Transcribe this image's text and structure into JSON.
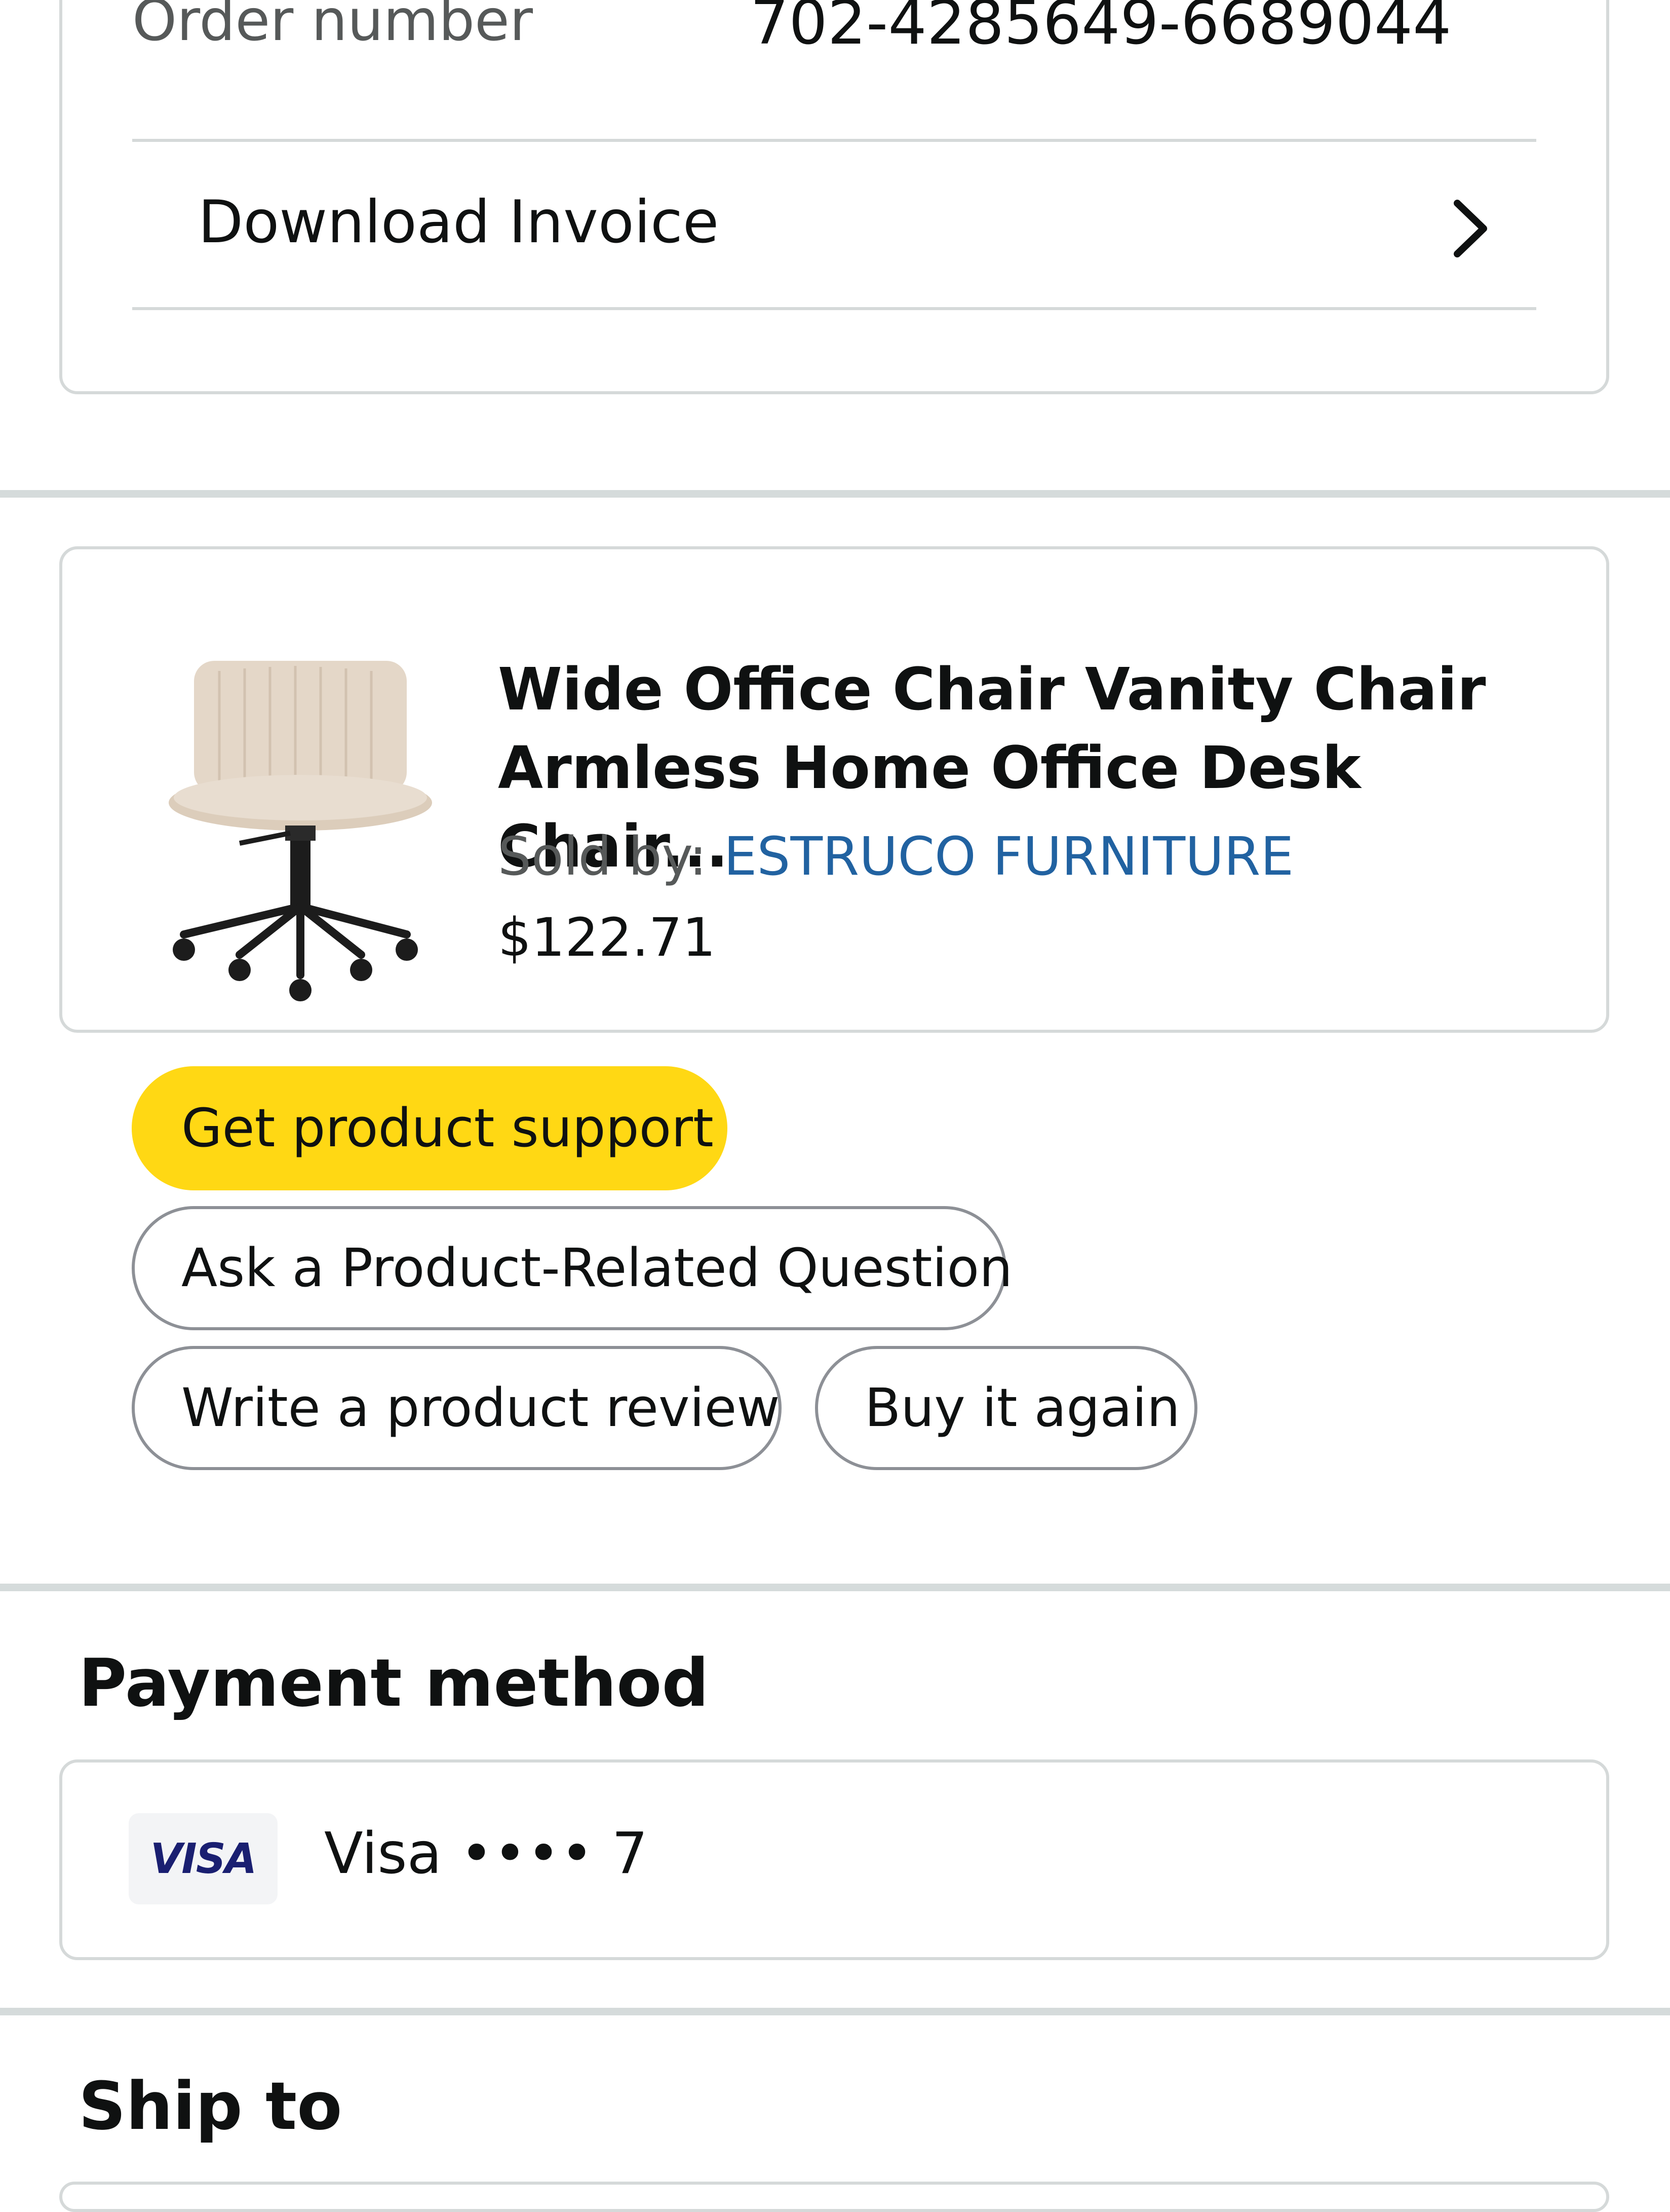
{
  "order": {
    "number_label": "Order number",
    "number_value": "702-4285649-6689044",
    "invoice_label": "Download Invoice"
  },
  "product": {
    "title": "Wide Office Chair Vanity Chair Armless Home Office Desk Chair...",
    "sold_by_label": "Sold by: ",
    "seller": "ESTRUCO FURNITURE",
    "price": "$122.71",
    "image_icon": "office-chair-image"
  },
  "actions": {
    "support": "Get product support",
    "question": "Ask a Product-Related Question",
    "review": "Write a product review",
    "buy_again": "Buy it again"
  },
  "payment": {
    "heading": "Payment method",
    "brand_logo": "VISA",
    "card_text": "Visa •••• 7"
  },
  "shipping": {
    "heading": "Ship to"
  },
  "colors": {
    "accent_button": "#ffd814",
    "link": "#2162a1",
    "border": "#d5d9d9"
  }
}
